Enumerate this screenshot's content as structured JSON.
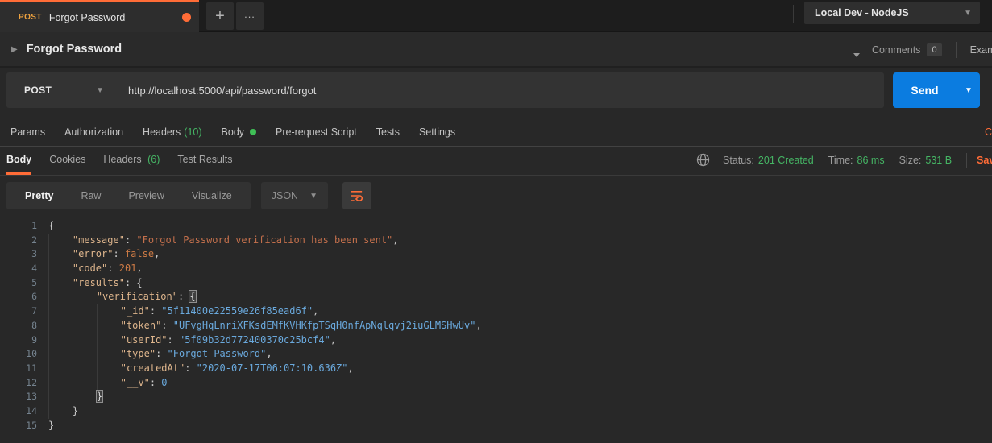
{
  "app": {
    "accent_color": "#ff6c37",
    "tab": {
      "method": "POST",
      "title": "Forgot Password"
    },
    "new_tab_icon": "+",
    "more_icon": "...",
    "environment": {
      "name": "Local Dev - NodeJS"
    }
  },
  "request": {
    "name": "Forgot Password",
    "comments": {
      "label": "Comments",
      "count": "0"
    },
    "examples_label": "Examples",
    "method": "POST",
    "url": "http://localhost:5000/api/password/forgot",
    "send_label": "Send",
    "tabs": [
      {
        "label": "Params"
      },
      {
        "label": "Authorization"
      },
      {
        "label": "Headers",
        "count": "(10)"
      },
      {
        "label": "Body",
        "dot": true
      },
      {
        "label": "Pre-request Script"
      },
      {
        "label": "Tests"
      },
      {
        "label": "Settings"
      }
    ],
    "cookies_link": "Cookies"
  },
  "response": {
    "tabs": [
      {
        "label": "Body",
        "active": true
      },
      {
        "label": "Cookies"
      },
      {
        "label": "Headers",
        "count": "(6)"
      },
      {
        "label": "Test Results"
      }
    ],
    "meta": {
      "status_label": "Status:",
      "status": "201 Created",
      "time_label": "Time:",
      "time": "86 ms",
      "size_label": "Size:",
      "size": "531 B"
    },
    "save_label": "Save Response",
    "view_tabs": [
      {
        "label": "Pretty",
        "active": true
      },
      {
        "label": "Raw"
      },
      {
        "label": "Preview"
      },
      {
        "label": "Visualize"
      }
    ],
    "language": "JSON"
  },
  "editor": {
    "lines": [
      {
        "indent": 0,
        "tokens": [
          [
            "pn",
            "{"
          ]
        ]
      },
      {
        "indent": 1,
        "tokens": [
          [
            "key",
            "\"message\""
          ],
          [
            "pn",
            ": "
          ],
          [
            "str",
            "\"Forgot Password verification has been sent\""
          ],
          [
            "pn",
            ","
          ]
        ]
      },
      {
        "indent": 1,
        "tokens": [
          [
            "key",
            "\"error\""
          ],
          [
            "pn",
            ": "
          ],
          [
            "num",
            "false"
          ],
          [
            "pn",
            ","
          ]
        ]
      },
      {
        "indent": 1,
        "tokens": [
          [
            "key",
            "\"code\""
          ],
          [
            "pn",
            ": "
          ],
          [
            "num",
            "201"
          ],
          [
            "pn",
            ","
          ]
        ]
      },
      {
        "indent": 1,
        "tokens": [
          [
            "key",
            "\"results\""
          ],
          [
            "pn",
            ": {"
          ]
        ]
      },
      {
        "indent": 2,
        "tokens": [
          [
            "key",
            "\"verification\""
          ],
          [
            "pn",
            ": "
          ],
          [
            "match",
            "{"
          ]
        ]
      },
      {
        "indent": 3,
        "tokens": [
          [
            "key",
            "\"_id\""
          ],
          [
            "pn",
            ": "
          ],
          [
            "blue",
            "\"5f11400e22559e26f85ead6f\""
          ],
          [
            "pn",
            ","
          ]
        ]
      },
      {
        "indent": 3,
        "tokens": [
          [
            "key",
            "\"token\""
          ],
          [
            "pn",
            ": "
          ],
          [
            "blue",
            "\"UFvgHqLnriXFKsdEMfKVHKfpTSqH0nfApNqlqvj2iuGLMSHwUv\""
          ],
          [
            "pn",
            ","
          ]
        ]
      },
      {
        "indent": 3,
        "tokens": [
          [
            "key",
            "\"userId\""
          ],
          [
            "pn",
            ": "
          ],
          [
            "blue",
            "\"5f09b32d772400370c25bcf4\""
          ],
          [
            "pn",
            ","
          ]
        ]
      },
      {
        "indent": 3,
        "tokens": [
          [
            "key",
            "\"type\""
          ],
          [
            "pn",
            ": "
          ],
          [
            "blue",
            "\"Forgot Password\""
          ],
          [
            "pn",
            ","
          ]
        ]
      },
      {
        "indent": 3,
        "tokens": [
          [
            "key",
            "\"createdAt\""
          ],
          [
            "pn",
            ": "
          ],
          [
            "blue",
            "\"2020-07-17T06:07:10.636Z\""
          ],
          [
            "pn",
            ","
          ]
        ]
      },
      {
        "indent": 3,
        "tokens": [
          [
            "key",
            "\"__v\""
          ],
          [
            "pn",
            ": "
          ],
          [
            "blue",
            "0"
          ]
        ]
      },
      {
        "indent": 2,
        "tokens": [
          [
            "match",
            "}"
          ]
        ]
      },
      {
        "indent": 1,
        "tokens": [
          [
            "pn",
            "}"
          ]
        ]
      },
      {
        "indent": 0,
        "tokens": [
          [
            "pn",
            "}"
          ]
        ]
      }
    ]
  }
}
